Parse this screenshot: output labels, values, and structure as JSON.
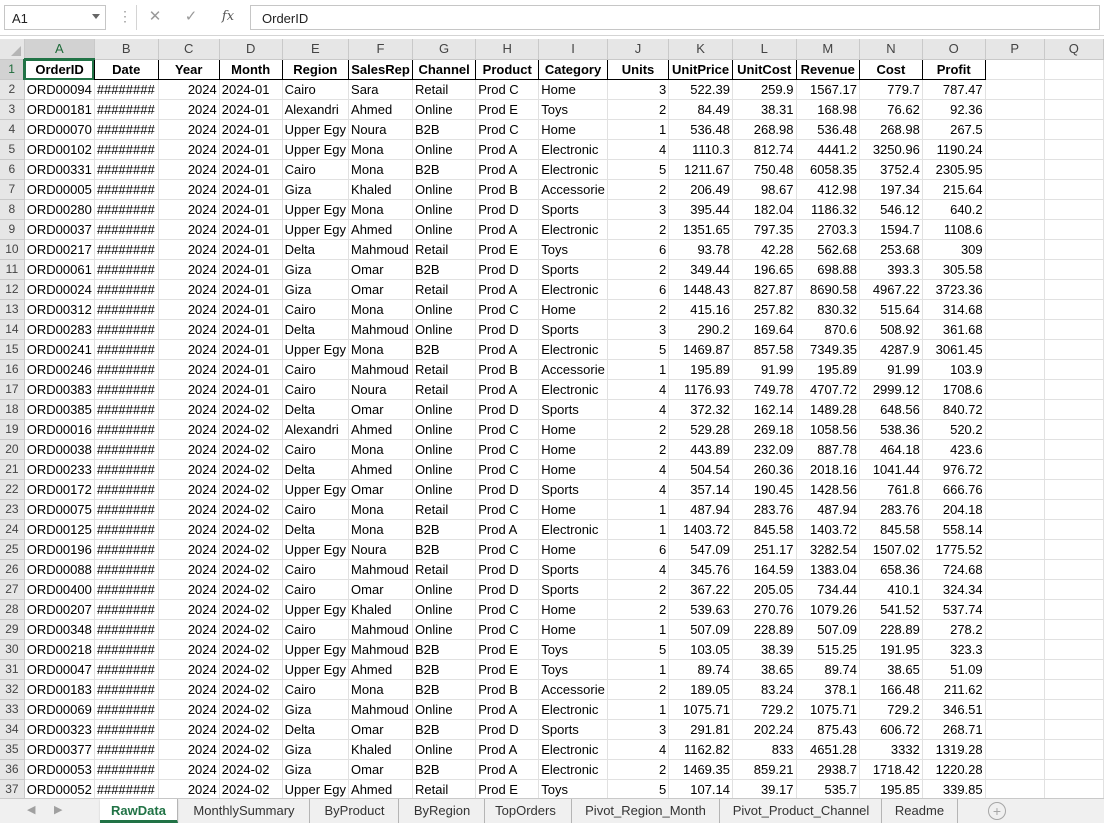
{
  "formula_bar": {
    "name_box": "A1",
    "cancel_icon": "✕",
    "enter_icon": "✓",
    "fx_label": "fx",
    "content": "OrderID"
  },
  "columns": [
    "A",
    "B",
    "C",
    "D",
    "E",
    "F",
    "G",
    "H",
    "I",
    "J",
    "K",
    "L",
    "M",
    "N",
    "O",
    "P",
    "Q"
  ],
  "table": {
    "headers": [
      "OrderID",
      "Date",
      "Year",
      "Month",
      "Region",
      "SalesRep",
      "Channel",
      "Product",
      "Category",
      "Units",
      "UnitPrice",
      "UnitCost",
      "Revenue",
      "Cost",
      "Profit"
    ],
    "rows": [
      [
        "ORD00094",
        "########",
        "2024",
        "2024-01",
        "Cairo",
        "Sara",
        "Retail",
        "Prod C",
        "Home",
        "3",
        "522.39",
        "259.9",
        "1567.17",
        "779.7",
        "787.47"
      ],
      [
        "ORD00181",
        "########",
        "2024",
        "2024-01",
        "Alexandri",
        "Ahmed",
        "Online",
        "Prod E",
        "Toys",
        "2",
        "84.49",
        "38.31",
        "168.98",
        "76.62",
        "92.36"
      ],
      [
        "ORD00070",
        "########",
        "2024",
        "2024-01",
        "Upper Egy",
        "Noura",
        "B2B",
        "Prod C",
        "Home",
        "1",
        "536.48",
        "268.98",
        "536.48",
        "268.98",
        "267.5"
      ],
      [
        "ORD00102",
        "########",
        "2024",
        "2024-01",
        "Upper Egy",
        "Mona",
        "Online",
        "Prod A",
        "Electronic",
        "4",
        "1110.3",
        "812.74",
        "4441.2",
        "3250.96",
        "1190.24"
      ],
      [
        "ORD00331",
        "########",
        "2024",
        "2024-01",
        "Cairo",
        "Mona",
        "B2B",
        "Prod A",
        "Electronic",
        "5",
        "1211.67",
        "750.48",
        "6058.35",
        "3752.4",
        "2305.95"
      ],
      [
        "ORD00005",
        "########",
        "2024",
        "2024-01",
        "Giza",
        "Khaled",
        "Online",
        "Prod B",
        "Accessorie",
        "2",
        "206.49",
        "98.67",
        "412.98",
        "197.34",
        "215.64"
      ],
      [
        "ORD00280",
        "########",
        "2024",
        "2024-01",
        "Upper Egy",
        "Mona",
        "Online",
        "Prod D",
        "Sports",
        "3",
        "395.44",
        "182.04",
        "1186.32",
        "546.12",
        "640.2"
      ],
      [
        "ORD00037",
        "########",
        "2024",
        "2024-01",
        "Upper Egy",
        "Ahmed",
        "Online",
        "Prod A",
        "Electronic",
        "2",
        "1351.65",
        "797.35",
        "2703.3",
        "1594.7",
        "1108.6"
      ],
      [
        "ORD00217",
        "########",
        "2024",
        "2024-01",
        "Delta",
        "Mahmoud",
        "Retail",
        "Prod E",
        "Toys",
        "6",
        "93.78",
        "42.28",
        "562.68",
        "253.68",
        "309"
      ],
      [
        "ORD00061",
        "########",
        "2024",
        "2024-01",
        "Giza",
        "Omar",
        "B2B",
        "Prod D",
        "Sports",
        "2",
        "349.44",
        "196.65",
        "698.88",
        "393.3",
        "305.58"
      ],
      [
        "ORD00024",
        "########",
        "2024",
        "2024-01",
        "Giza",
        "Omar",
        "Retail",
        "Prod A",
        "Electronic",
        "6",
        "1448.43",
        "827.87",
        "8690.58",
        "4967.22",
        "3723.36"
      ],
      [
        "ORD00312",
        "########",
        "2024",
        "2024-01",
        "Cairo",
        "Mona",
        "Online",
        "Prod C",
        "Home",
        "2",
        "415.16",
        "257.82",
        "830.32",
        "515.64",
        "314.68"
      ],
      [
        "ORD00283",
        "########",
        "2024",
        "2024-01",
        "Delta",
        "Mahmoud",
        "Online",
        "Prod D",
        "Sports",
        "3",
        "290.2",
        "169.64",
        "870.6",
        "508.92",
        "361.68"
      ],
      [
        "ORD00241",
        "########",
        "2024",
        "2024-01",
        "Upper Egy",
        "Mona",
        "B2B",
        "Prod A",
        "Electronic",
        "5",
        "1469.87",
        "857.58",
        "7349.35",
        "4287.9",
        "3061.45"
      ],
      [
        "ORD00246",
        "########",
        "2024",
        "2024-01",
        "Cairo",
        "Mahmoud",
        "Retail",
        "Prod B",
        "Accessorie",
        "1",
        "195.89",
        "91.99",
        "195.89",
        "91.99",
        "103.9"
      ],
      [
        "ORD00383",
        "########",
        "2024",
        "2024-01",
        "Cairo",
        "Noura",
        "Retail",
        "Prod A",
        "Electronic",
        "4",
        "1176.93",
        "749.78",
        "4707.72",
        "2999.12",
        "1708.6"
      ],
      [
        "ORD00385",
        "########",
        "2024",
        "2024-02",
        "Delta",
        "Omar",
        "Online",
        "Prod D",
        "Sports",
        "4",
        "372.32",
        "162.14",
        "1489.28",
        "648.56",
        "840.72"
      ],
      [
        "ORD00016",
        "########",
        "2024",
        "2024-02",
        "Alexandri",
        "Ahmed",
        "Online",
        "Prod C",
        "Home",
        "2",
        "529.28",
        "269.18",
        "1058.56",
        "538.36",
        "520.2"
      ],
      [
        "ORD00038",
        "########",
        "2024",
        "2024-02",
        "Cairo",
        "Mona",
        "Online",
        "Prod C",
        "Home",
        "2",
        "443.89",
        "232.09",
        "887.78",
        "464.18",
        "423.6"
      ],
      [
        "ORD00233",
        "########",
        "2024",
        "2024-02",
        "Delta",
        "Ahmed",
        "Online",
        "Prod C",
        "Home",
        "4",
        "504.54",
        "260.36",
        "2018.16",
        "1041.44",
        "976.72"
      ],
      [
        "ORD00172",
        "########",
        "2024",
        "2024-02",
        "Upper Egy",
        "Omar",
        "Online",
        "Prod D",
        "Sports",
        "4",
        "357.14",
        "190.45",
        "1428.56",
        "761.8",
        "666.76"
      ],
      [
        "ORD00075",
        "########",
        "2024",
        "2024-02",
        "Cairo",
        "Mona",
        "Retail",
        "Prod C",
        "Home",
        "1",
        "487.94",
        "283.76",
        "487.94",
        "283.76",
        "204.18"
      ],
      [
        "ORD00125",
        "########",
        "2024",
        "2024-02",
        "Delta",
        "Mona",
        "B2B",
        "Prod A",
        "Electronic",
        "1",
        "1403.72",
        "845.58",
        "1403.72",
        "845.58",
        "558.14"
      ],
      [
        "ORD00196",
        "########",
        "2024",
        "2024-02",
        "Upper Egy",
        "Noura",
        "B2B",
        "Prod C",
        "Home",
        "6",
        "547.09",
        "251.17",
        "3282.54",
        "1507.02",
        "1775.52"
      ],
      [
        "ORD00088",
        "########",
        "2024",
        "2024-02",
        "Cairo",
        "Mahmoud",
        "Retail",
        "Prod D",
        "Sports",
        "4",
        "345.76",
        "164.59",
        "1383.04",
        "658.36",
        "724.68"
      ],
      [
        "ORD00400",
        "########",
        "2024",
        "2024-02",
        "Cairo",
        "Omar",
        "Online",
        "Prod D",
        "Sports",
        "2",
        "367.22",
        "205.05",
        "734.44",
        "410.1",
        "324.34"
      ],
      [
        "ORD00207",
        "########",
        "2024",
        "2024-02",
        "Upper Egy",
        "Khaled",
        "Online",
        "Prod C",
        "Home",
        "2",
        "539.63",
        "270.76",
        "1079.26",
        "541.52",
        "537.74"
      ],
      [
        "ORD00348",
        "########",
        "2024",
        "2024-02",
        "Cairo",
        "Mahmoud",
        "Online",
        "Prod C",
        "Home",
        "1",
        "507.09",
        "228.89",
        "507.09",
        "228.89",
        "278.2"
      ],
      [
        "ORD00218",
        "########",
        "2024",
        "2024-02",
        "Upper Egy",
        "Mahmoud",
        "B2B",
        "Prod E",
        "Toys",
        "5",
        "103.05",
        "38.39",
        "515.25",
        "191.95",
        "323.3"
      ],
      [
        "ORD00047",
        "########",
        "2024",
        "2024-02",
        "Upper Egy",
        "Ahmed",
        "B2B",
        "Prod E",
        "Toys",
        "1",
        "89.74",
        "38.65",
        "89.74",
        "38.65",
        "51.09"
      ],
      [
        "ORD00183",
        "########",
        "2024",
        "2024-02",
        "Cairo",
        "Mona",
        "B2B",
        "Prod B",
        "Accessorie",
        "2",
        "189.05",
        "83.24",
        "378.1",
        "166.48",
        "211.62"
      ],
      [
        "ORD00069",
        "########",
        "2024",
        "2024-02",
        "Giza",
        "Mahmoud",
        "Online",
        "Prod A",
        "Electronic",
        "1",
        "1075.71",
        "729.2",
        "1075.71",
        "729.2",
        "346.51"
      ],
      [
        "ORD00323",
        "########",
        "2024",
        "2024-02",
        "Delta",
        "Omar",
        "B2B",
        "Prod D",
        "Sports",
        "3",
        "291.81",
        "202.24",
        "875.43",
        "606.72",
        "268.71"
      ],
      [
        "ORD00377",
        "########",
        "2024",
        "2024-02",
        "Giza",
        "Khaled",
        "Online",
        "Prod A",
        "Electronic",
        "4",
        "1162.82",
        "833",
        "4651.28",
        "3332",
        "1319.28"
      ],
      [
        "ORD00053",
        "########",
        "2024",
        "2024-02",
        "Giza",
        "Omar",
        "B2B",
        "Prod A",
        "Electronic",
        "2",
        "1469.35",
        "859.21",
        "2938.7",
        "1718.42",
        "1220.28"
      ],
      [
        "ORD00052",
        "########",
        "2024",
        "2024-02",
        "Upper Egy",
        "Ahmed",
        "Retail",
        "Prod E",
        "Toys",
        "5",
        "107.14",
        "39.17",
        "535.7",
        "195.85",
        "339.85"
      ]
    ]
  },
  "sheet_tabs": [
    "RawData",
    "MonthlySummary",
    "ByProduct",
    "ByRegion",
    "TopOrders",
    "Pivot_Region_Month",
    "Pivot_Product_Channel",
    "Readme"
  ],
  "active_sheet": "RawData",
  "colors": {
    "accent": "#217346",
    "header_bg": "#e6e6e6",
    "gridline": "#e1e1e1"
  }
}
